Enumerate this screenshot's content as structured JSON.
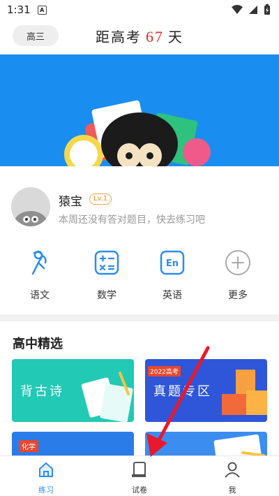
{
  "status_bar": {
    "time": "1:31",
    "notif_letter": "A"
  },
  "header": {
    "grade": "高三",
    "countdown_prefix": "距高考",
    "countdown_days": "67",
    "countdown_suffix": "天"
  },
  "profile": {
    "name": "猿宝",
    "level": "Lv.1",
    "hint": "本周还没有答对题目，快去练习吧"
  },
  "subjects": [
    {
      "label": "语文",
      "icon": "chinese-icon"
    },
    {
      "label": "数学",
      "icon": "math-icon"
    },
    {
      "label": "英语",
      "icon": "english-icon",
      "icon_text": "En"
    },
    {
      "label": "更多",
      "icon": "plus-icon"
    }
  ],
  "picks": {
    "title": "高中精选",
    "cards": [
      {
        "title": "背古诗"
      },
      {
        "badge": "2022高考",
        "title": "真题专区"
      },
      {
        "badge": "化学"
      }
    ]
  },
  "tabbar": {
    "tabs": [
      {
        "label": "练习",
        "active": true
      },
      {
        "label": "试卷",
        "active": false
      },
      {
        "label": "我",
        "active": false
      }
    ]
  },
  "colors": {
    "accent": "#2a8cf0",
    "banner": "#1a8ef0",
    "countdown_number": "#e02a2a",
    "annotation_arrow": "#e8192c"
  }
}
